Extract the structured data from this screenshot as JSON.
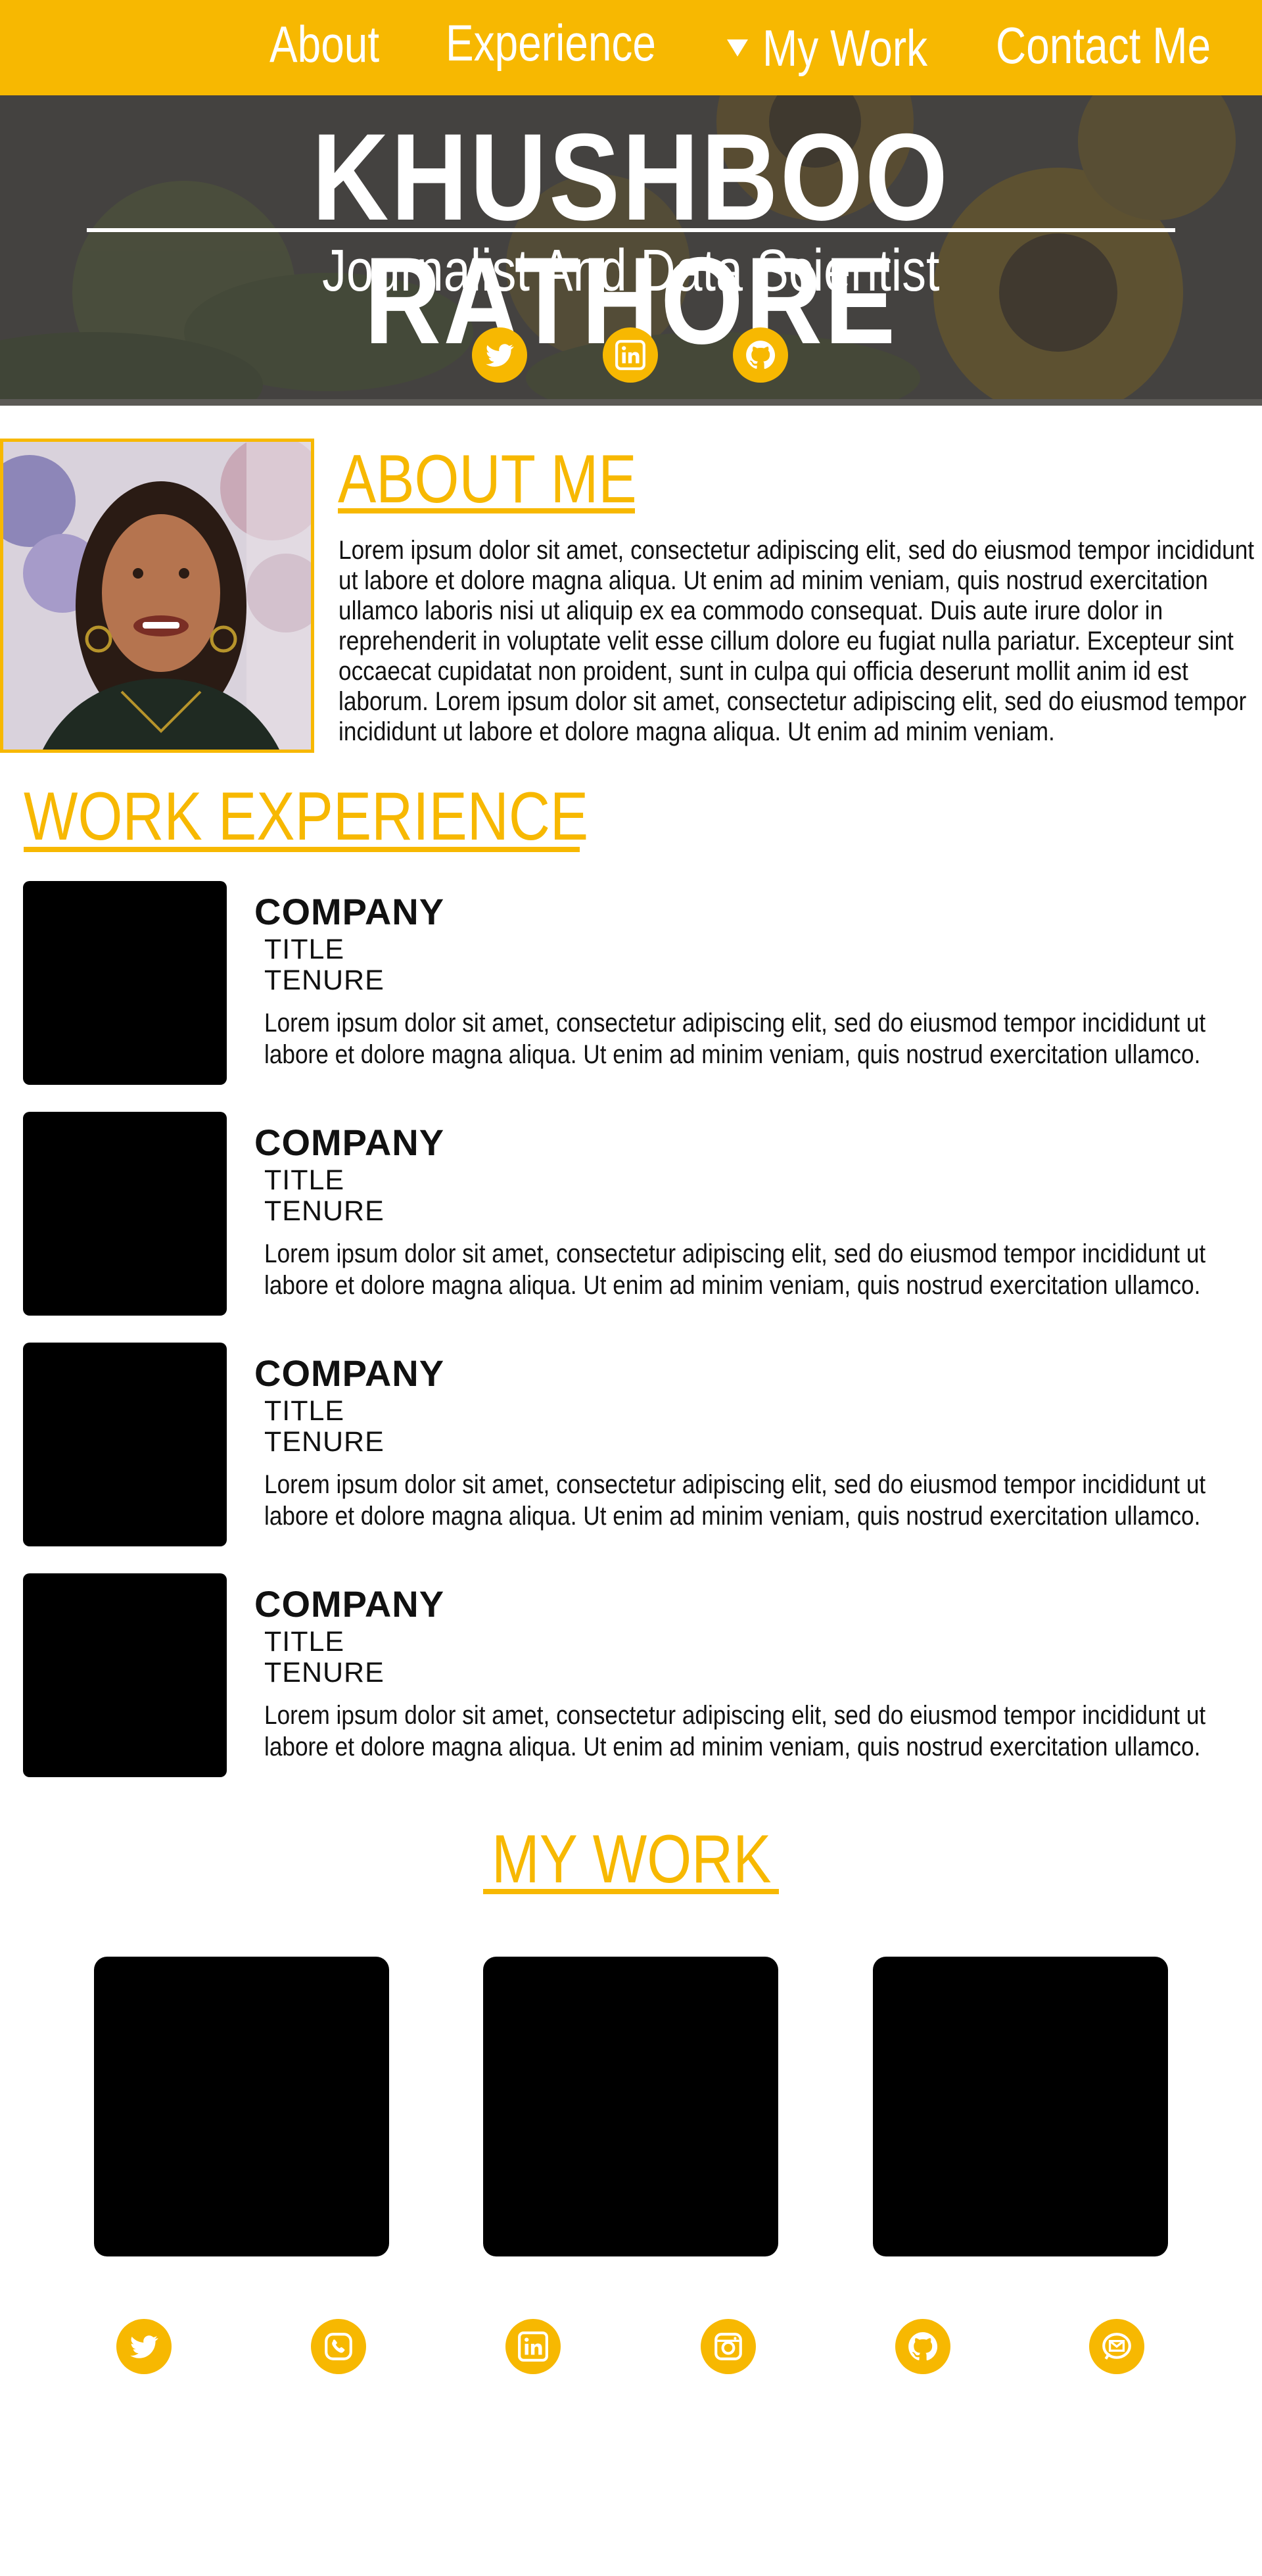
{
  "nav": {
    "items": [
      {
        "label": "About"
      },
      {
        "label": "Experience"
      },
      {
        "label": "My Work"
      },
      {
        "label": "Contact Me"
      }
    ]
  },
  "hero": {
    "name": "KHUSHBOO RATHORE",
    "subtitle": "Journalist And Data Scientist",
    "social_icons": [
      "twitter-icon",
      "linkedin-icon",
      "github-icon"
    ]
  },
  "about": {
    "heading": "ABOUT ME",
    "body": "Lorem ipsum dolor sit amet, consectetur adipiscing elit, sed do eiusmod tempor incididunt ut labore et dolore magna aliqua. Ut enim ad minim veniam, quis nostrud exercitation ullamco laboris nisi ut aliquip ex ea commodo consequat. Duis aute irure dolor in reprehenderit in voluptate velit esse cillum dolore eu fugiat nulla pariatur. Excepteur sint occaecat cupidatat non proident, sunt in culpa qui officia deserunt mollit anim id est laborum. Lorem ipsum dolor sit amet, consectetur adipiscing elit, sed do eiusmod tempor incididunt ut labore et dolore magna aliqua. Ut enim ad minim veniam."
  },
  "experience": {
    "heading": "WORK EXPERIENCE",
    "items": [
      {
        "company": "COMPANY",
        "title": "TITLE",
        "tenure": "TENURE",
        "description": "Lorem ipsum dolor sit amet, consectetur adipiscing elit, sed do eiusmod tempor incididunt ut labore et dolore magna aliqua. Ut enim ad minim veniam, quis nostrud exercitation ullamco."
      },
      {
        "company": "COMPANY",
        "title": "TITLE",
        "tenure": "TENURE",
        "description": "Lorem ipsum dolor sit amet, consectetur adipiscing elit, sed do eiusmod tempor incididunt ut labore et dolore magna aliqua. Ut enim ad minim veniam, quis nostrud exercitation ullamco."
      },
      {
        "company": "COMPANY",
        "title": "TITLE",
        "tenure": "TENURE",
        "description": "Lorem ipsum dolor sit amet, consectetur adipiscing elit, sed do eiusmod tempor incididunt ut labore et dolore magna aliqua. Ut enim ad minim veniam, quis nostrud exercitation ullamco."
      },
      {
        "company": "COMPANY",
        "title": "TITLE",
        "tenure": "TENURE",
        "description": "Lorem ipsum dolor sit amet, consectetur adipiscing elit, sed do eiusmod tempor incididunt ut labore et dolore magna aliqua. Ut enim ad minim veniam, quis nostrud exercitation ullamco."
      }
    ]
  },
  "work": {
    "heading": "MY WORK"
  },
  "footer": {
    "icons": [
      "twitter-icon",
      "phone-icon",
      "linkedin-icon",
      "instagram-icon",
      "github-icon",
      "email-icon"
    ]
  },
  "colors": {
    "accent": "#f7b801",
    "hero_bg": "#4d4b48",
    "text": "#111111"
  }
}
